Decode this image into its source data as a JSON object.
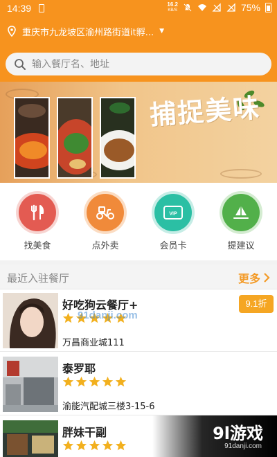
{
  "status_bar": {
    "time": "14:39",
    "net_speed": "16.2",
    "net_unit": "KB/S",
    "battery": "75%"
  },
  "header": {
    "location": "重庆市九龙坡区渝州路街道it孵...",
    "search_placeholder": "输入餐厅名、地址",
    "background_color": "#f7931e"
  },
  "banner": {
    "title": "捕捉美味"
  },
  "quick_menu": [
    {
      "label": "找美食",
      "icon": "fork-knife-icon",
      "color": "#e35b52"
    },
    {
      "label": "点外卖",
      "icon": "scooter-icon",
      "color": "#f08a3a"
    },
    {
      "label": "会员卡",
      "icon": "vip-card-icon",
      "color": "#2bbfa4"
    },
    {
      "label": "提建议",
      "icon": "paper-plane-icon",
      "color": "#52b04a"
    }
  ],
  "section": {
    "title": "最近入驻餐厅",
    "more_label": "更多"
  },
  "restaurants": [
    {
      "name": "好吃狗云餐厅+",
      "rating": 5,
      "address": "万昌商业城111",
      "badge": "9.1折"
    },
    {
      "name": "泰罗耶",
      "rating": 5,
      "address": "渝能汽配城三楼3-15-6",
      "badge": ""
    },
    {
      "name": "胖妹干副",
      "rating": 5,
      "address": "",
      "badge": ""
    }
  ],
  "watermark": {
    "main": "9l游戏",
    "sub": "91danji.com",
    "faint": "91danji.com"
  }
}
